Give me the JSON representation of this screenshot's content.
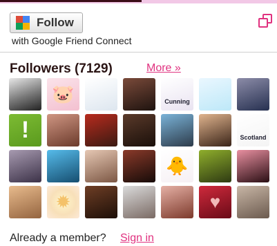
{
  "follow_button": {
    "label": "Follow"
  },
  "connect_text": "with Google Friend Connect",
  "followers": {
    "title": "Followers (7129)",
    "more_link": "More »"
  },
  "member_prompt": {
    "text": "Already a member?",
    "link": "Sign in"
  },
  "colors": {
    "accent": "#e0317f",
    "title": "#2b1515"
  },
  "avatars": [
    {
      "bg": "linear-gradient(160deg,#e8e8e8,#777 55%,#222)",
      "sym": "",
      "tag": ""
    },
    {
      "bg": "linear-gradient(160deg,#fbe3ea,#f3c0d0)",
      "sym": "🐷",
      "tag": ""
    },
    {
      "bg": "linear-gradient(160deg,#ffffff,#dde6ef)",
      "sym": "",
      "tag": ""
    },
    {
      "bg": "linear-gradient(160deg,#7a4a3a,#1e130f)",
      "sym": "",
      "tag": ""
    },
    {
      "bg": "linear-gradient(160deg,#ffffff,#e9e3f1)",
      "sym": "",
      "tag": "Cunning"
    },
    {
      "bg": "linear-gradient(160deg,#eaf7ff,#bde8f8)",
      "sym": "",
      "tag": ""
    },
    {
      "bg": "linear-gradient(160deg,#8c8ca8,#263050)",
      "sym": "",
      "tag": ""
    },
    {
      "bg": "linear-gradient(160deg,#7dbb33,#5a9a1e)",
      "sym": "!",
      "tag": ""
    },
    {
      "bg": "linear-gradient(160deg,#cf9683,#6b3a2b)",
      "sym": "",
      "tag": ""
    },
    {
      "bg": "linear-gradient(160deg,#b82b1e,#3a1a12)",
      "sym": "",
      "tag": ""
    },
    {
      "bg": "linear-gradient(160deg,#5a3a2a,#1a0f0a)",
      "sym": "",
      "tag": ""
    },
    {
      "bg": "linear-gradient(160deg,#7ab3d8,#2d3b4a)",
      "sym": "",
      "tag": ""
    },
    {
      "bg": "linear-gradient(160deg,#e0b48e,#3a2418)",
      "sym": "",
      "tag": ""
    },
    {
      "bg": "linear-gradient(160deg,#ffffff,#f4f4f4)",
      "sym": "",
      "tag": "Scotland"
    },
    {
      "bg": "linear-gradient(160deg,#a79ab0,#3c3248)",
      "sym": "",
      "tag": ""
    },
    {
      "bg": "linear-gradient(160deg,#56bbea,#164e70)",
      "sym": "",
      "tag": ""
    },
    {
      "bg": "linear-gradient(160deg,#e5c7b3,#7c5744)",
      "sym": "",
      "tag": ""
    },
    {
      "bg": "linear-gradient(160deg,#8a3a2a,#160b08)",
      "sym": "",
      "tag": ""
    },
    {
      "bg": "linear-gradient(160deg,#ffffff,#f6f0f4)",
      "sym": "🐥",
      "tag": ""
    },
    {
      "bg": "linear-gradient(160deg,#8fae2c,#2e3a12)",
      "sym": "",
      "tag": ""
    },
    {
      "bg": "linear-gradient(160deg,#e88fa0,#2a0f14)",
      "sym": "",
      "tag": ""
    },
    {
      "bg": "linear-gradient(160deg,#e8bb8d,#94643f)",
      "sym": "",
      "tag": ""
    },
    {
      "bg": "radial-gradient(circle,#fff6c9,#f8e0b9 55%,#fce9d8)",
      "sym": "✹",
      "tag": ""
    },
    {
      "bg": "linear-gradient(160deg,#6e3e25,#1d0f08)",
      "sym": "",
      "tag": ""
    },
    {
      "bg": "linear-gradient(160deg,#dadada,#7a6a64)",
      "sym": "",
      "tag": ""
    },
    {
      "bg": "linear-gradient(160deg,#e5b0a5,#7d3a2c)",
      "sym": "",
      "tag": ""
    },
    {
      "bg": "linear-gradient(160deg,#ce2a3c,#6a0a17)",
      "sym": "♥",
      "tag": ""
    },
    {
      "bg": "linear-gradient(160deg,#c8b6a6,#6b5a4e)",
      "sym": "",
      "tag": ""
    }
  ]
}
